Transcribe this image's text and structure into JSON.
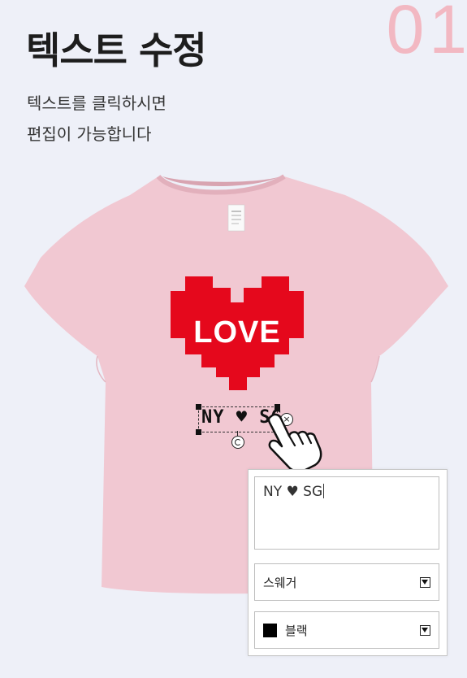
{
  "header": {
    "step_number": "01",
    "title": "텍스트 수정",
    "description_lines": [
      "텍스트를 클릭하시면",
      "편집이 가능합니다"
    ]
  },
  "design": {
    "graphic_text": "LOVE",
    "text_object": "NY ♥ SG",
    "shirt_color": "#f1c8d2",
    "heart_color": "#e5081c"
  },
  "edit_panel": {
    "text_value": "NY ♥ SG",
    "font_select": "스웨거",
    "color_select": "블랙",
    "color_swatch": "#000000"
  },
  "icons": {
    "cursor": "hand-pointer-icon",
    "delete": "close-circle-icon",
    "rotate": "rotate-icon",
    "dropdown": "chevron-down-icon"
  }
}
